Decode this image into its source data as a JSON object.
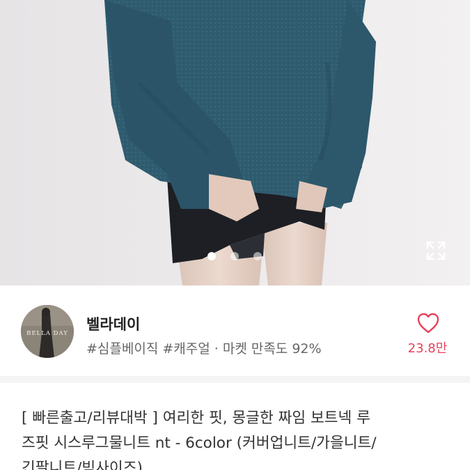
{
  "product_image": {
    "description_icon": "product-photo",
    "slide_count": 3,
    "active_slide": 1,
    "expand_icon": "expand-icon"
  },
  "seller": {
    "avatar_text": "BELLA DAY",
    "name": "벨라데이",
    "tags": "#심플베이직 #캐주얼 · 마켓 만족도 92%",
    "likes": "23.8만",
    "like_icon": "heart-outline-icon"
  },
  "product": {
    "title_line1": "[ 빠른출고/리뷰대박 ] 여리한 핏, 몽글한 짜임 보트넥 루",
    "title_line2": "즈핏 시스루그물니트 nt - 6color (커버업니트/가을니트/",
    "title_line3": "긴팔니트/빅사이즈)"
  },
  "colors": {
    "accent": "#e8425b",
    "sweater": "#2f5a6e"
  }
}
